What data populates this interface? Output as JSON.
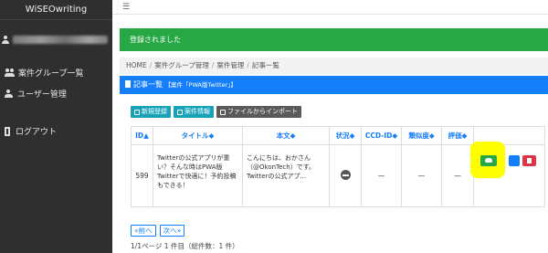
{
  "brand": "WiSEOwriting",
  "sidebar": {
    "items": [
      {
        "label": "案件グループ一覧",
        "icon": "users-icon"
      },
      {
        "label": "ユーザー管理",
        "icon": "user-gear-icon"
      },
      {
        "label": "ログアウト",
        "icon": "logout-icon"
      }
    ]
  },
  "alert": {
    "text": "登録されました",
    "color": "#27a844"
  },
  "breadcrumb": [
    "HOME",
    "案件グループ管理",
    "案件管理",
    "記事一覧"
  ],
  "card": {
    "title": "記事一覧",
    "subtitle": "【案件「PWA版Twitter」】",
    "color": "#157efb"
  },
  "toolbar": {
    "new_label": "新規登録",
    "edit_label": "案件情報",
    "import_label": "ファイルからインポート"
  },
  "table": {
    "headers": [
      "ID▲",
      "タイトル◆",
      "本文◆",
      "状況◆",
      "CCD-ID◆",
      "類似度◆",
      "評価◆",
      ""
    ],
    "rows": [
      {
        "id": "599",
        "title": "Twitterの公式アプリが重い？そんな時はPWA版Twitterで快適に！予約投稿もできる！",
        "body": "こんにちは、おかさん（@OkonTech）です。Twitterの公式アプ...",
        "ccd_id": "—",
        "similarity": "—",
        "rating": "—"
      }
    ]
  },
  "pager": {
    "prev": "«前へ",
    "next": "次へ»",
    "info": "1/1ページ 1 件目（総件数：1 件）"
  }
}
